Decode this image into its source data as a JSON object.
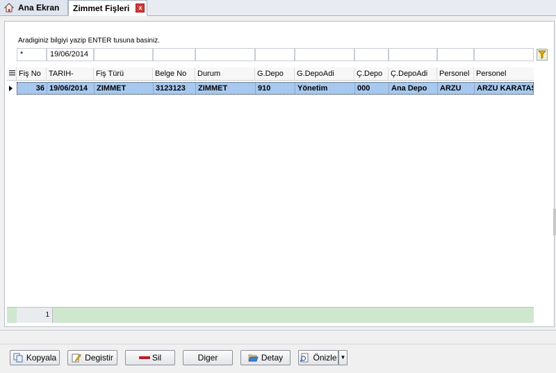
{
  "tabs": [
    {
      "label": "Ana Ekran",
      "icon": "home-icon"
    },
    {
      "label": "Zimmet Fişleri",
      "close": "x"
    }
  ],
  "search": {
    "hint": "Aradiginiz bilgiyi yazip ENTER tusuna basiniz.",
    "filters": [
      "*",
      "19/06/2014",
      "",
      "",
      "",
      "",
      "",
      "",
      "",
      "",
      ""
    ]
  },
  "grid": {
    "columns": [
      "Fiş No",
      "TARIH-",
      "Fiş Türü",
      "Belge No",
      "Durum",
      "G.Depo",
      "G.DepoAdi",
      "Ç.Depo",
      "Ç.DepoAdi",
      "Personel",
      "Personel"
    ],
    "rows": [
      [
        "36",
        "19/06/2014",
        "ZIMMET",
        "3123123",
        "ZIMMET",
        "910",
        "Yönetim",
        "000",
        "Ana Depo",
        "ARZU",
        "ARZU KARATAŞ"
      ]
    ],
    "footer_count": "1"
  },
  "buttons": {
    "kopyala": "Kopyala",
    "degistir": "Degistir",
    "sil": "Sil",
    "diger": "Diger",
    "detay": "Detay",
    "onizle": "Önizle"
  },
  "colors": {
    "selected_row": "#a7c8ef",
    "footer": "#cfe6cf",
    "delete_icon": "#c0182a"
  }
}
